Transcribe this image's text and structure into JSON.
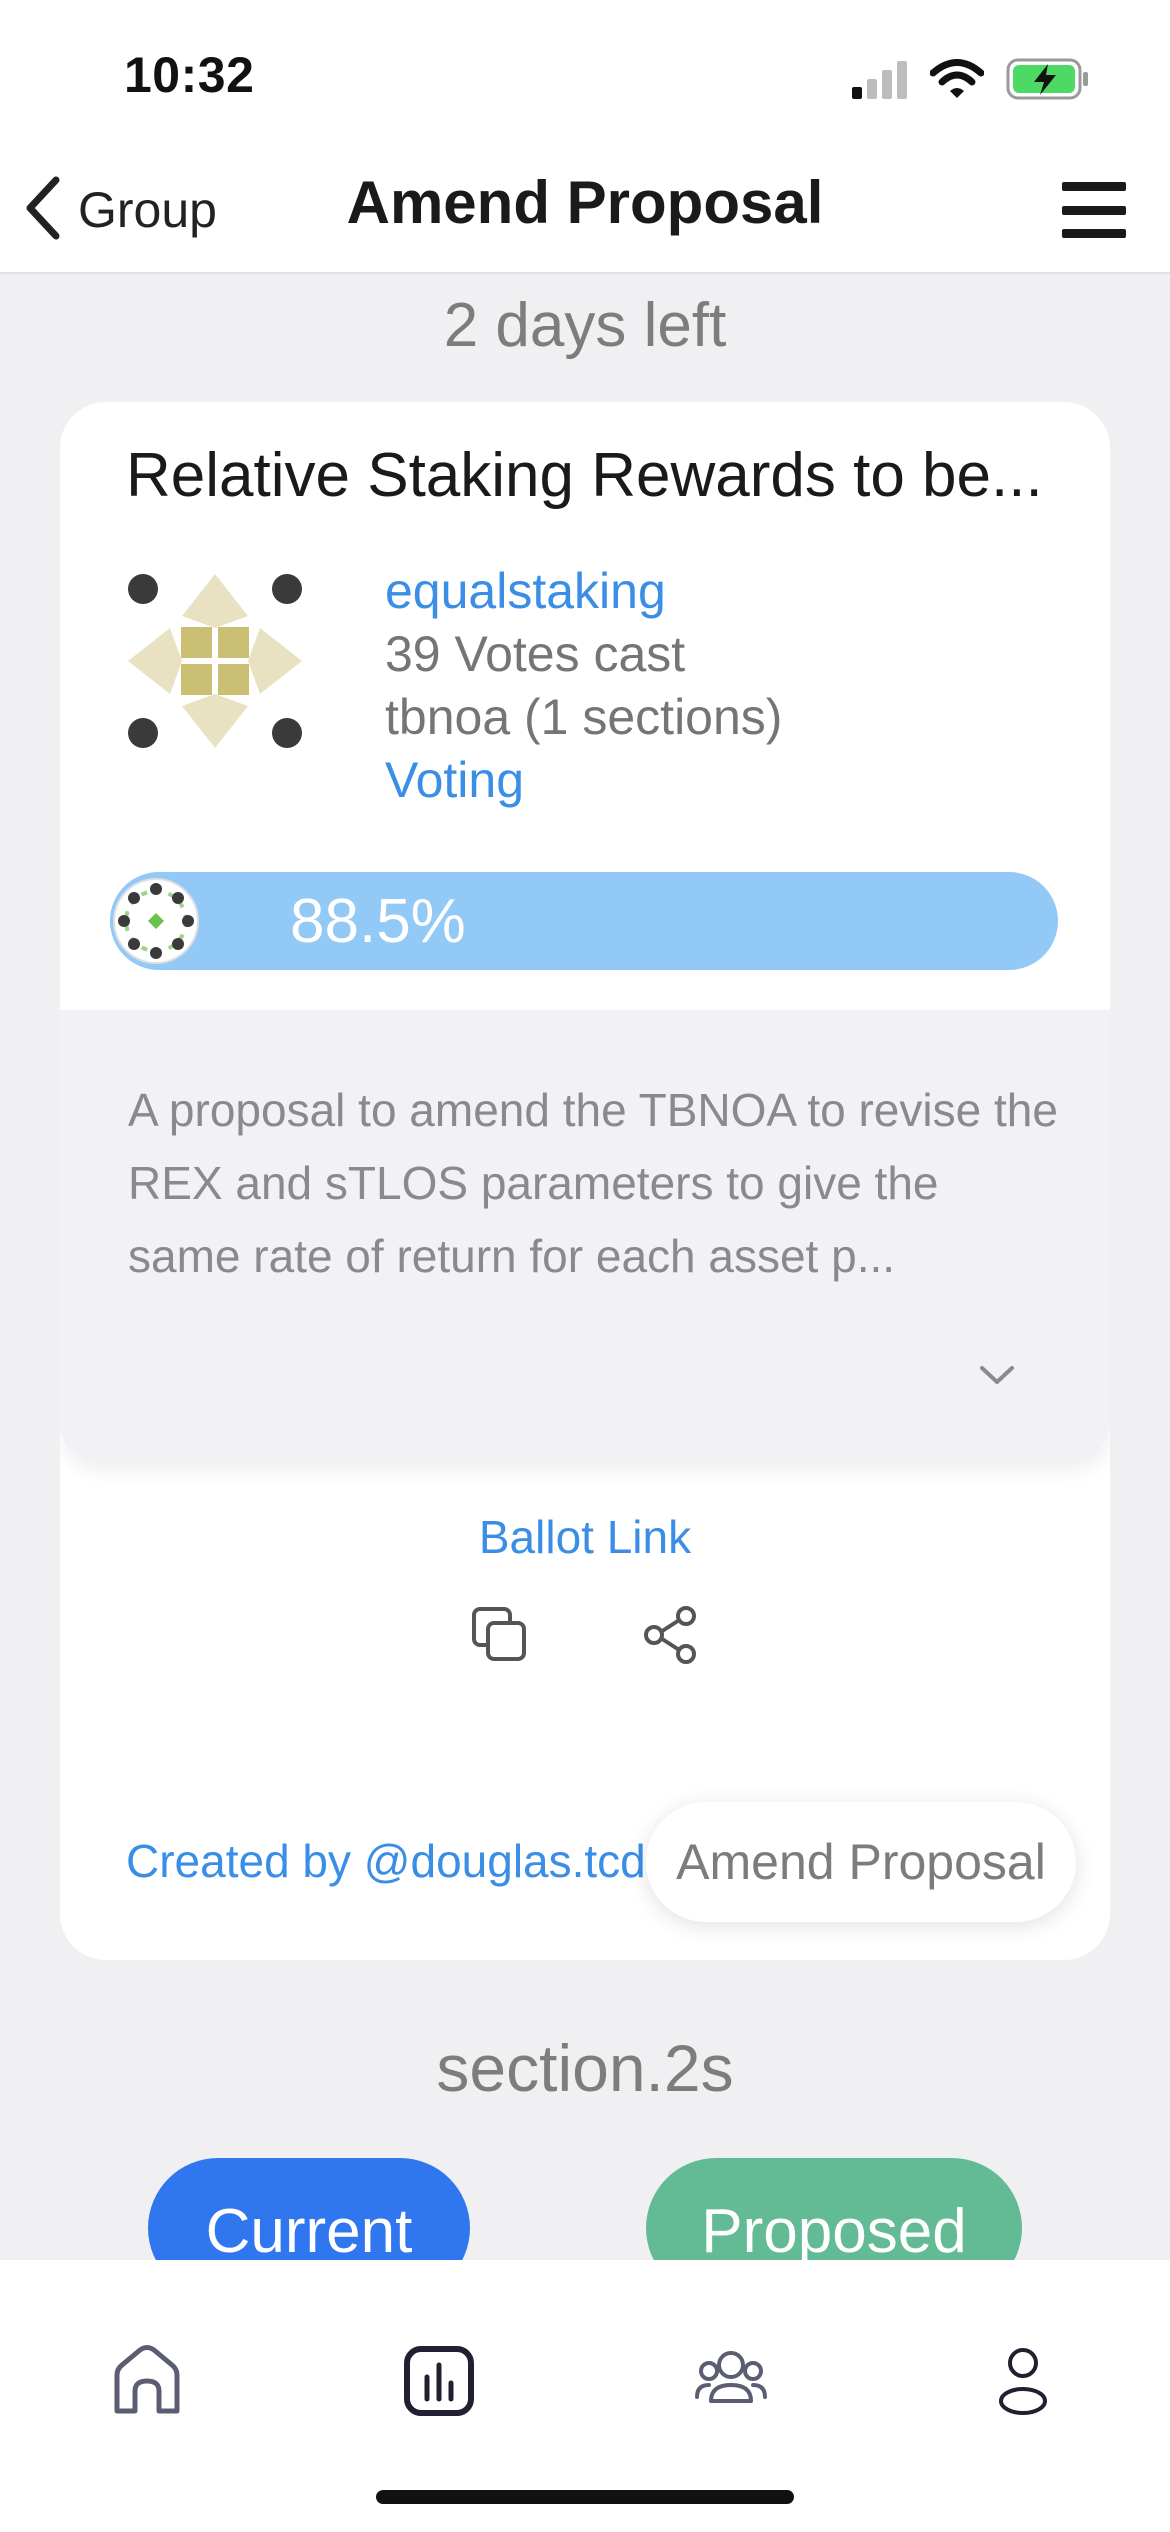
{
  "status_bar": {
    "time": "10:32",
    "icons": [
      "cellular-signal-icon",
      "wifi-icon",
      "battery-charging-icon"
    ]
  },
  "nav": {
    "back_label": "Group",
    "title": "Amend Proposal",
    "menu_icon": "hamburger-menu-icon"
  },
  "time_left": "2 days left",
  "proposal": {
    "title": "Relative Staking Rewards to be...",
    "group_name": "equalstaking",
    "votes_cast": "39 Votes cast",
    "document": "tbnoa (1 sections)",
    "status": "Voting",
    "approval_percent_label": "88.5%",
    "approval_fraction": 0.885,
    "description": "A proposal to amend the TBNOA to revise the REX and sTLOS parameters to give the same rate of return for each asset p...",
    "ballot_link_label": "Ballot Link",
    "created_by": "Created by @douglas.tcd",
    "amend_button_label": "Amend Proposal"
  },
  "section": {
    "name": "section.2s",
    "current_label": "Current",
    "proposed_label": "Proposed"
  },
  "tab_bar": {
    "tabs": [
      "home-icon",
      "stats-icon",
      "groups-icon",
      "profile-icon"
    ]
  },
  "colors": {
    "accent_blue": "#3a8ee6",
    "progress_blue": "#93c9f6",
    "current_blue": "#2f76ef",
    "proposed_green": "#63bb96",
    "battery_green": "#4cd964"
  }
}
